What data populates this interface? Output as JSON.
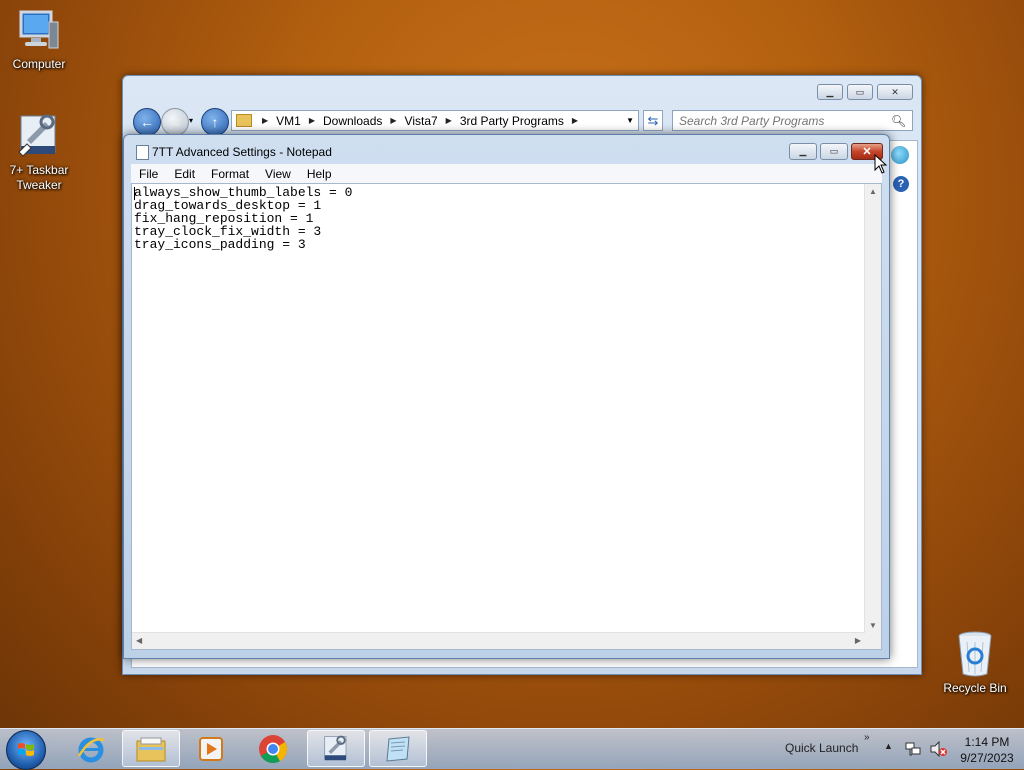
{
  "desktop": {
    "icons": [
      {
        "label": "Computer"
      },
      {
        "label": "7+ Taskbar\nTweaker"
      },
      {
        "label": "Recycle Bin"
      }
    ]
  },
  "explorer": {
    "breadcrumbs": [
      "VM1",
      "Downloads",
      "Vista7",
      "3rd Party Programs"
    ],
    "search_placeholder": "Search 3rd Party Programs"
  },
  "notepad": {
    "title": "7TT Advanced Settings - Notepad",
    "menu": [
      "File",
      "Edit",
      "Format",
      "View",
      "Help"
    ],
    "content": "always_show_thumb_labels = 0\ndrag_towards_desktop = 1\nfix_hang_reposition = 1\ntray_clock_fix_width = 3\ntray_icons_padding = 3"
  },
  "taskbar": {
    "quick_launch_label": "Quick Launch",
    "time": "1:14 PM",
    "date": "9/27/2023"
  },
  "colors": {
    "accent_close": "#c4452a",
    "desktop_bg": "#b3600f"
  }
}
